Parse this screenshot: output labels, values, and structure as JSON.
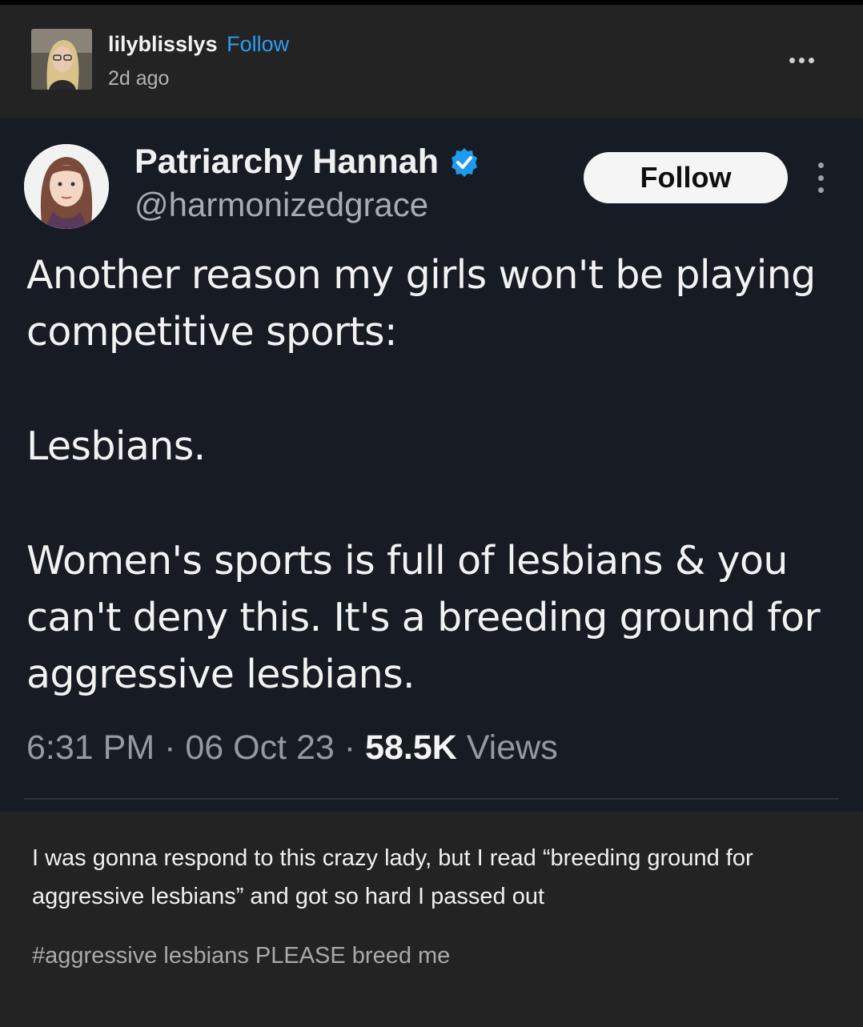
{
  "post": {
    "username": "lilyblisslys",
    "follow_label": "Follow",
    "time_ago": "2d ago",
    "more_icon": "ellipsis-icon"
  },
  "tweet": {
    "display_name": "Patriarchy Hannah",
    "handle": "@harmonizedgrace",
    "follow_label": "Follow",
    "verified_icon": "verified-badge-icon",
    "paragraphs": [
      "Another reason my girls won't be playing competitive sports:",
      "Lesbians.",
      "Women's sports is full of lesbians & you can't deny this. It's a breeding ground for aggressive lesbians."
    ],
    "time": "6:31 PM",
    "separator": "·",
    "date": "06 Oct 23",
    "views_count": "58.5K",
    "views_label": "Views",
    "colors": {
      "background": "#161b24",
      "verified": "#1d9bf0"
    }
  },
  "caption": {
    "text": "I was gonna respond to this crazy lady, but I read “breeding ground for aggressive lesbians” and got so hard I passed out",
    "tags": "#aggressive lesbians PLEASE breed me"
  },
  "colors": {
    "page_background": "#232323",
    "follow_link": "#2d9cf2"
  }
}
